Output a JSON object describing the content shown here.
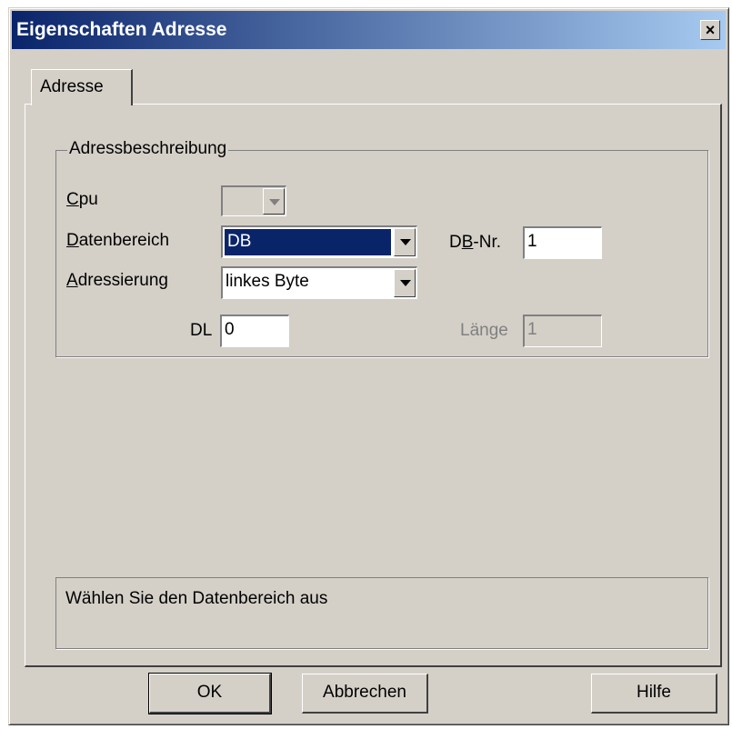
{
  "window": {
    "title": "Eigenschaften Adresse",
    "close_glyph": "×"
  },
  "tabs": [
    {
      "label": "Adresse",
      "active": true
    }
  ],
  "group": {
    "label": "Adressbeschreibung",
    "cpu": {
      "label_first": "C",
      "label_rest": "pu",
      "value": "",
      "enabled": false
    },
    "datenbereich": {
      "label_first": "D",
      "label_rest": "atenbereich",
      "value": "DB",
      "selected": true
    },
    "adressierung": {
      "label_first": "A",
      "label_rest": "dressierung",
      "value": "linkes Byte"
    },
    "dbnr": {
      "label_pre": "D",
      "label_u": "B",
      "label_post": "-Nr.",
      "value": "1"
    },
    "dl": {
      "label": "DL",
      "value": "0"
    },
    "laenge": {
      "label": "Länge",
      "value": "1",
      "enabled": false
    }
  },
  "status_text": "Wählen Sie den Datenbereich aus",
  "buttons": {
    "ok": "OK",
    "cancel": "Abbrechen",
    "help": "Hilfe"
  },
  "colors": {
    "title_start": "#0a246a",
    "title_end": "#a6caf0",
    "face": "#d4d0c8",
    "selection": "#0a246a"
  }
}
